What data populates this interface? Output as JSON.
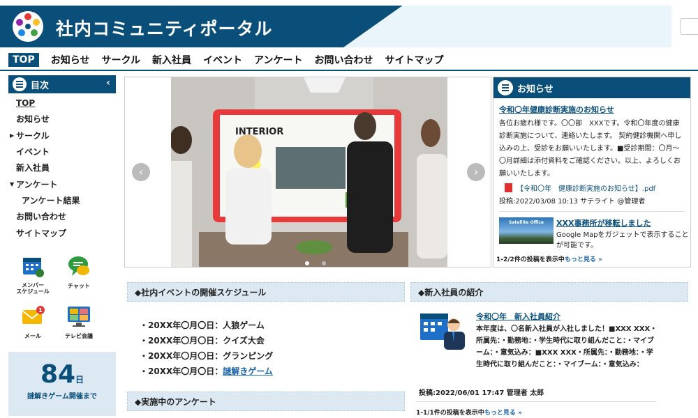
{
  "header": {
    "title": "社内コミュニティポータル"
  },
  "nav": [
    "TOP",
    "お知らせ",
    "サークル",
    "新入社員",
    "イベント",
    "アンケート",
    "お問い合わせ",
    "サイトマップ"
  ],
  "sidebar": {
    "title": "目次",
    "items": [
      "TOP",
      "お知らせ",
      "サークル",
      "イベント",
      "新入社員",
      "アンケート",
      "アンケート結果",
      "お問い合わせ",
      "サイトマップ"
    ],
    "apps": [
      {
        "label": "メンバー\nスケジュール",
        "icon": "calendar-icon"
      },
      {
        "label": "チャット",
        "icon": "chat-icon"
      },
      {
        "label": "メール",
        "icon": "mail-icon",
        "badge": "1"
      },
      {
        "label": "テレビ会議",
        "icon": "video-meeting-icon"
      }
    ],
    "countdown": {
      "number": "84",
      "unit": "日",
      "label": "謎解きゲーム開催まで"
    }
  },
  "slider": {
    "image": "meeting-photo",
    "dots": 2,
    "active_dot": 0
  },
  "news": {
    "title": "お知らせ",
    "item1": {
      "title": "令和〇年健康診断実施のお知らせ",
      "text": "各位お疲れ様です。〇〇部　XXXです。令和〇年度の健康診断実施について、連絡いたします。 契約健診機関へ申し込みの上、受診をお願いいたします。■受診期間：〇月～〇月詳細は添付資料をご確認ください。以上、よろしくお願いいたします。",
      "file": "【令和〇年　健康診断実施のお知らせ】.pdf",
      "meta": "投稿:2022/03/08 10:13 サテライト @管理者"
    },
    "item2": {
      "title": "XXX事務所が移転しました",
      "text": "Google Mapをガジェットで表示することが可能です。",
      "thumb_text": "Satellite Office"
    },
    "count": "1-2/2件の投稿を表示中",
    "more": "もっと見る »"
  },
  "events": {
    "title": "◆社内イベントの開催スケジュール",
    "items": [
      {
        "text": "・20XX年〇月〇日：人狼ゲーム"
      },
      {
        "text": "・20XX年〇月〇日：クイズ大会"
      },
      {
        "text": "・20XX年〇月〇日：グランピング"
      },
      {
        "text": "・20XX年〇月〇日：",
        "link": "謎解きゲーム"
      }
    ]
  },
  "survey": {
    "title": "◆実施中のアンケート"
  },
  "newcomers": {
    "title": "◆新入社員の紹介",
    "post_title": "令和〇年　新入社員紹介",
    "text": "本年度は、〇名新入社員が入社しました！■XXX XXX・所属先：・勤務地：・学生時代に取り組んだこと：・マイブーム：・意気込み：■XXX XXX・所属先：・勤務地：・学生時代に取り組んだこと：・マイブーム：・意気込み：",
    "meta": "投稿:2022/06/01 17:47 管理者 太郎",
    "count": "1-1/1件の投稿を表示中",
    "more": "もっと見る »"
  },
  "colors": {
    "brand": "#0a4f7a",
    "link": "#1a63a8",
    "panel": "#dde9f2"
  }
}
